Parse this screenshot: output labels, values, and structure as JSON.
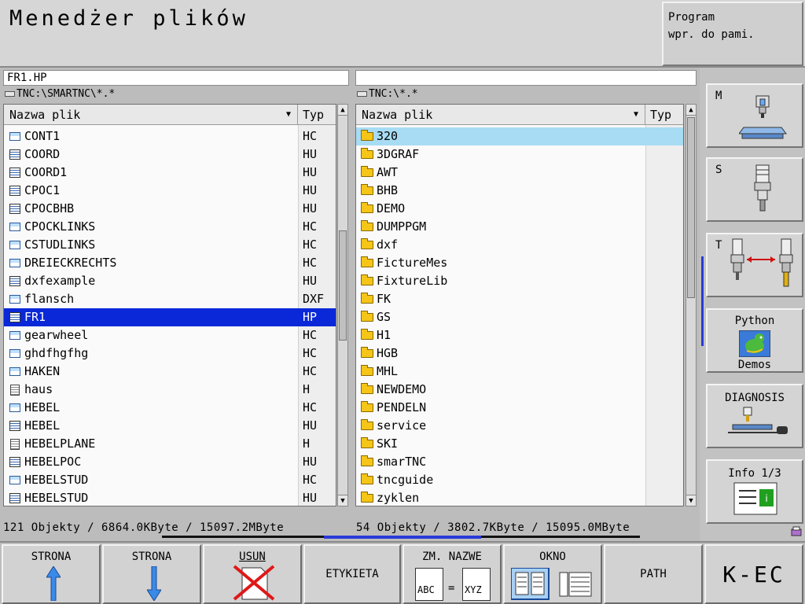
{
  "header": {
    "title": "Menedżer plików",
    "mode_line1": "Program",
    "mode_line2": "wpr. do pami."
  },
  "left_panel": {
    "selected_file": "FR1.HP",
    "directory": "TNC:\\SMARTNC\\*.*",
    "col_name": "Nazwa plik",
    "col_type": "Typ",
    "files": [
      {
        "name": "CONT1",
        "type": "HC",
        "icon": "contour-file-icon"
      },
      {
        "name": "COORD",
        "type": "HU",
        "icon": "program-file-icon"
      },
      {
        "name": "COORD1",
        "type": "HU",
        "icon": "program-file-icon"
      },
      {
        "name": "CPOC1",
        "type": "HU",
        "icon": "program-file-icon"
      },
      {
        "name": "CPOCBHB",
        "type": "HU",
        "icon": "program-file-icon"
      },
      {
        "name": "CPOCKLINKS",
        "type": "HC",
        "icon": "contour-file-icon"
      },
      {
        "name": "CSTUDLINKS",
        "type": "HC",
        "icon": "contour-file-icon"
      },
      {
        "name": "DREIECKRECHTS",
        "type": "HC",
        "icon": "contour-file-icon"
      },
      {
        "name": "dxfexample",
        "type": "HU",
        "icon": "program-file-icon"
      },
      {
        "name": "flansch",
        "type": "DXF",
        "icon": "dxf-file-icon"
      },
      {
        "name": "FR1",
        "type": "HP",
        "icon": "point-file-icon"
      },
      {
        "name": "gearwheel",
        "type": "HC",
        "icon": "contour-file-icon"
      },
      {
        "name": "ghdfhgfhg",
        "type": "HC",
        "icon": "contour-file-icon"
      },
      {
        "name": "HAKEN",
        "type": "HC",
        "icon": "contour-file-icon"
      },
      {
        "name": "haus",
        "type": "H",
        "icon": "text-file-icon"
      },
      {
        "name": "HEBEL",
        "type": "HC",
        "icon": "contour-file-icon"
      },
      {
        "name": "HEBEL",
        "type": "HU",
        "icon": "program-file-icon"
      },
      {
        "name": "HEBELPLANE",
        "type": "H",
        "icon": "text-file-icon"
      },
      {
        "name": "HEBELPOC",
        "type": "HU",
        "icon": "program-file-icon"
      },
      {
        "name": "HEBELSTUD",
        "type": "HC",
        "icon": "contour-file-icon"
      },
      {
        "name": "HEBELSTUD",
        "type": "HU",
        "icon": "program-file-icon"
      }
    ],
    "status": "121 Objekty / 6864.0KByte / 15097.2MByte"
  },
  "right_panel": {
    "path_value": "",
    "directory": "TNC:\\*.*",
    "col_name": "Nazwa plik",
    "col_type": "Typ",
    "folders": [
      "320",
      "3DGRAF",
      "AWT",
      "BHB",
      "DEMO",
      "DUMPPGM",
      "dxf",
      "FictureMes",
      "FixtureLib",
      "FK",
      "GS",
      "H1",
      "HGB",
      "MHL",
      "NEWDEMO",
      "PENDELN",
      "service",
      "SKI",
      "smarTNC",
      "tncguide",
      "zyklen"
    ],
    "status": "54 Objekty / 3802.7KByte / 15095.0MByte"
  },
  "side": {
    "m_label": "M",
    "s_label": "S",
    "t_label": "T",
    "python_top": "Python",
    "python_bottom": "Demos",
    "diagnosis": "DIAGNOSIS",
    "info": "Info 1/3"
  },
  "softkeys": {
    "page_up": "STRONA",
    "page_down": "STRONA",
    "delete": "USUN",
    "tag": "ETYKIETA",
    "rename": "ZM. NAZWE",
    "rename_from": "ABC",
    "rename_eq": "=",
    "rename_to": "XYZ",
    "window": "OKNO",
    "path": "PATH",
    "end": "K-EC"
  },
  "colors": {
    "selection_blue": "#0a28d8",
    "selection_light": "#a8dcf4",
    "folder_yellow": "#f5c518"
  }
}
